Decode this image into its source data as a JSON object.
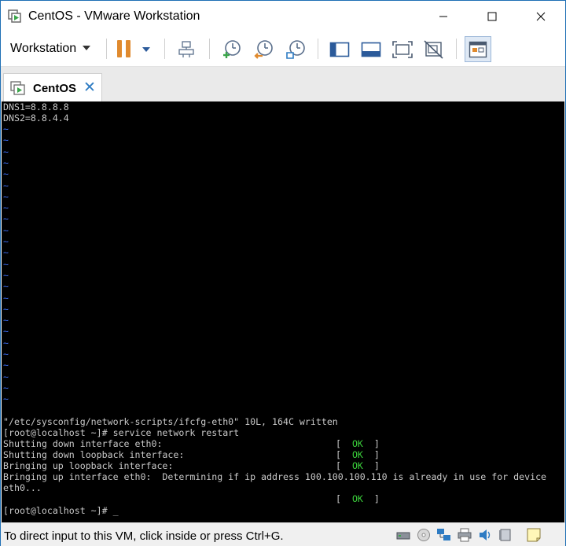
{
  "window": {
    "title": "CentOS - VMware Workstation"
  },
  "toolbar": {
    "workstation_menu": "Workstation",
    "icons": [
      "pause-icon",
      "send-keys-icon",
      "snapshot-icon",
      "revert-snapshot-icon",
      "snapshot-manager-icon",
      "console-view-icon",
      "library-icon",
      "fit-guest-icon",
      "unity-icon",
      "full-screen-icon"
    ]
  },
  "tab": {
    "label": "CentOS",
    "close_glyph": "✕"
  },
  "console": {
    "top_lines": [
      "DNS1=8.8.8.8",
      "DNS2=8.8.4.4"
    ],
    "tilde_char": "~",
    "tilde_count": 25,
    "written_line": "\"/etc/sysconfig/network-scripts/ifcfg-eth0\" 10L, 164C written",
    "prompt_restart": "[root@localhost ~]# service network restart",
    "status_lines": [
      "Shutting down interface eth0:",
      "Shutting down loopback interface:",
      "Bringing up loopback interface:"
    ],
    "bringing_up_eth0_line1": "Bringing up interface eth0:  Determining if ip address 100.100.100.110 is already in use for device",
    "bringing_up_eth0_line2": "eth0...",
    "ok_open": "[",
    "ok_text": "OK",
    "ok_close": "]",
    "final_prompt": "[root@localhost ~]# _"
  },
  "statusbar": {
    "hint": "To direct input to this VM, click inside or press Ctrl+G."
  },
  "colors": {
    "console_bg": "#000000",
    "console_text": "#c8c8c8",
    "tilde": "#3b6cf2",
    "ok_green": "#3bd03b",
    "accent_blue": "#2d7bc3",
    "pause_orange": "#e08a2e"
  }
}
